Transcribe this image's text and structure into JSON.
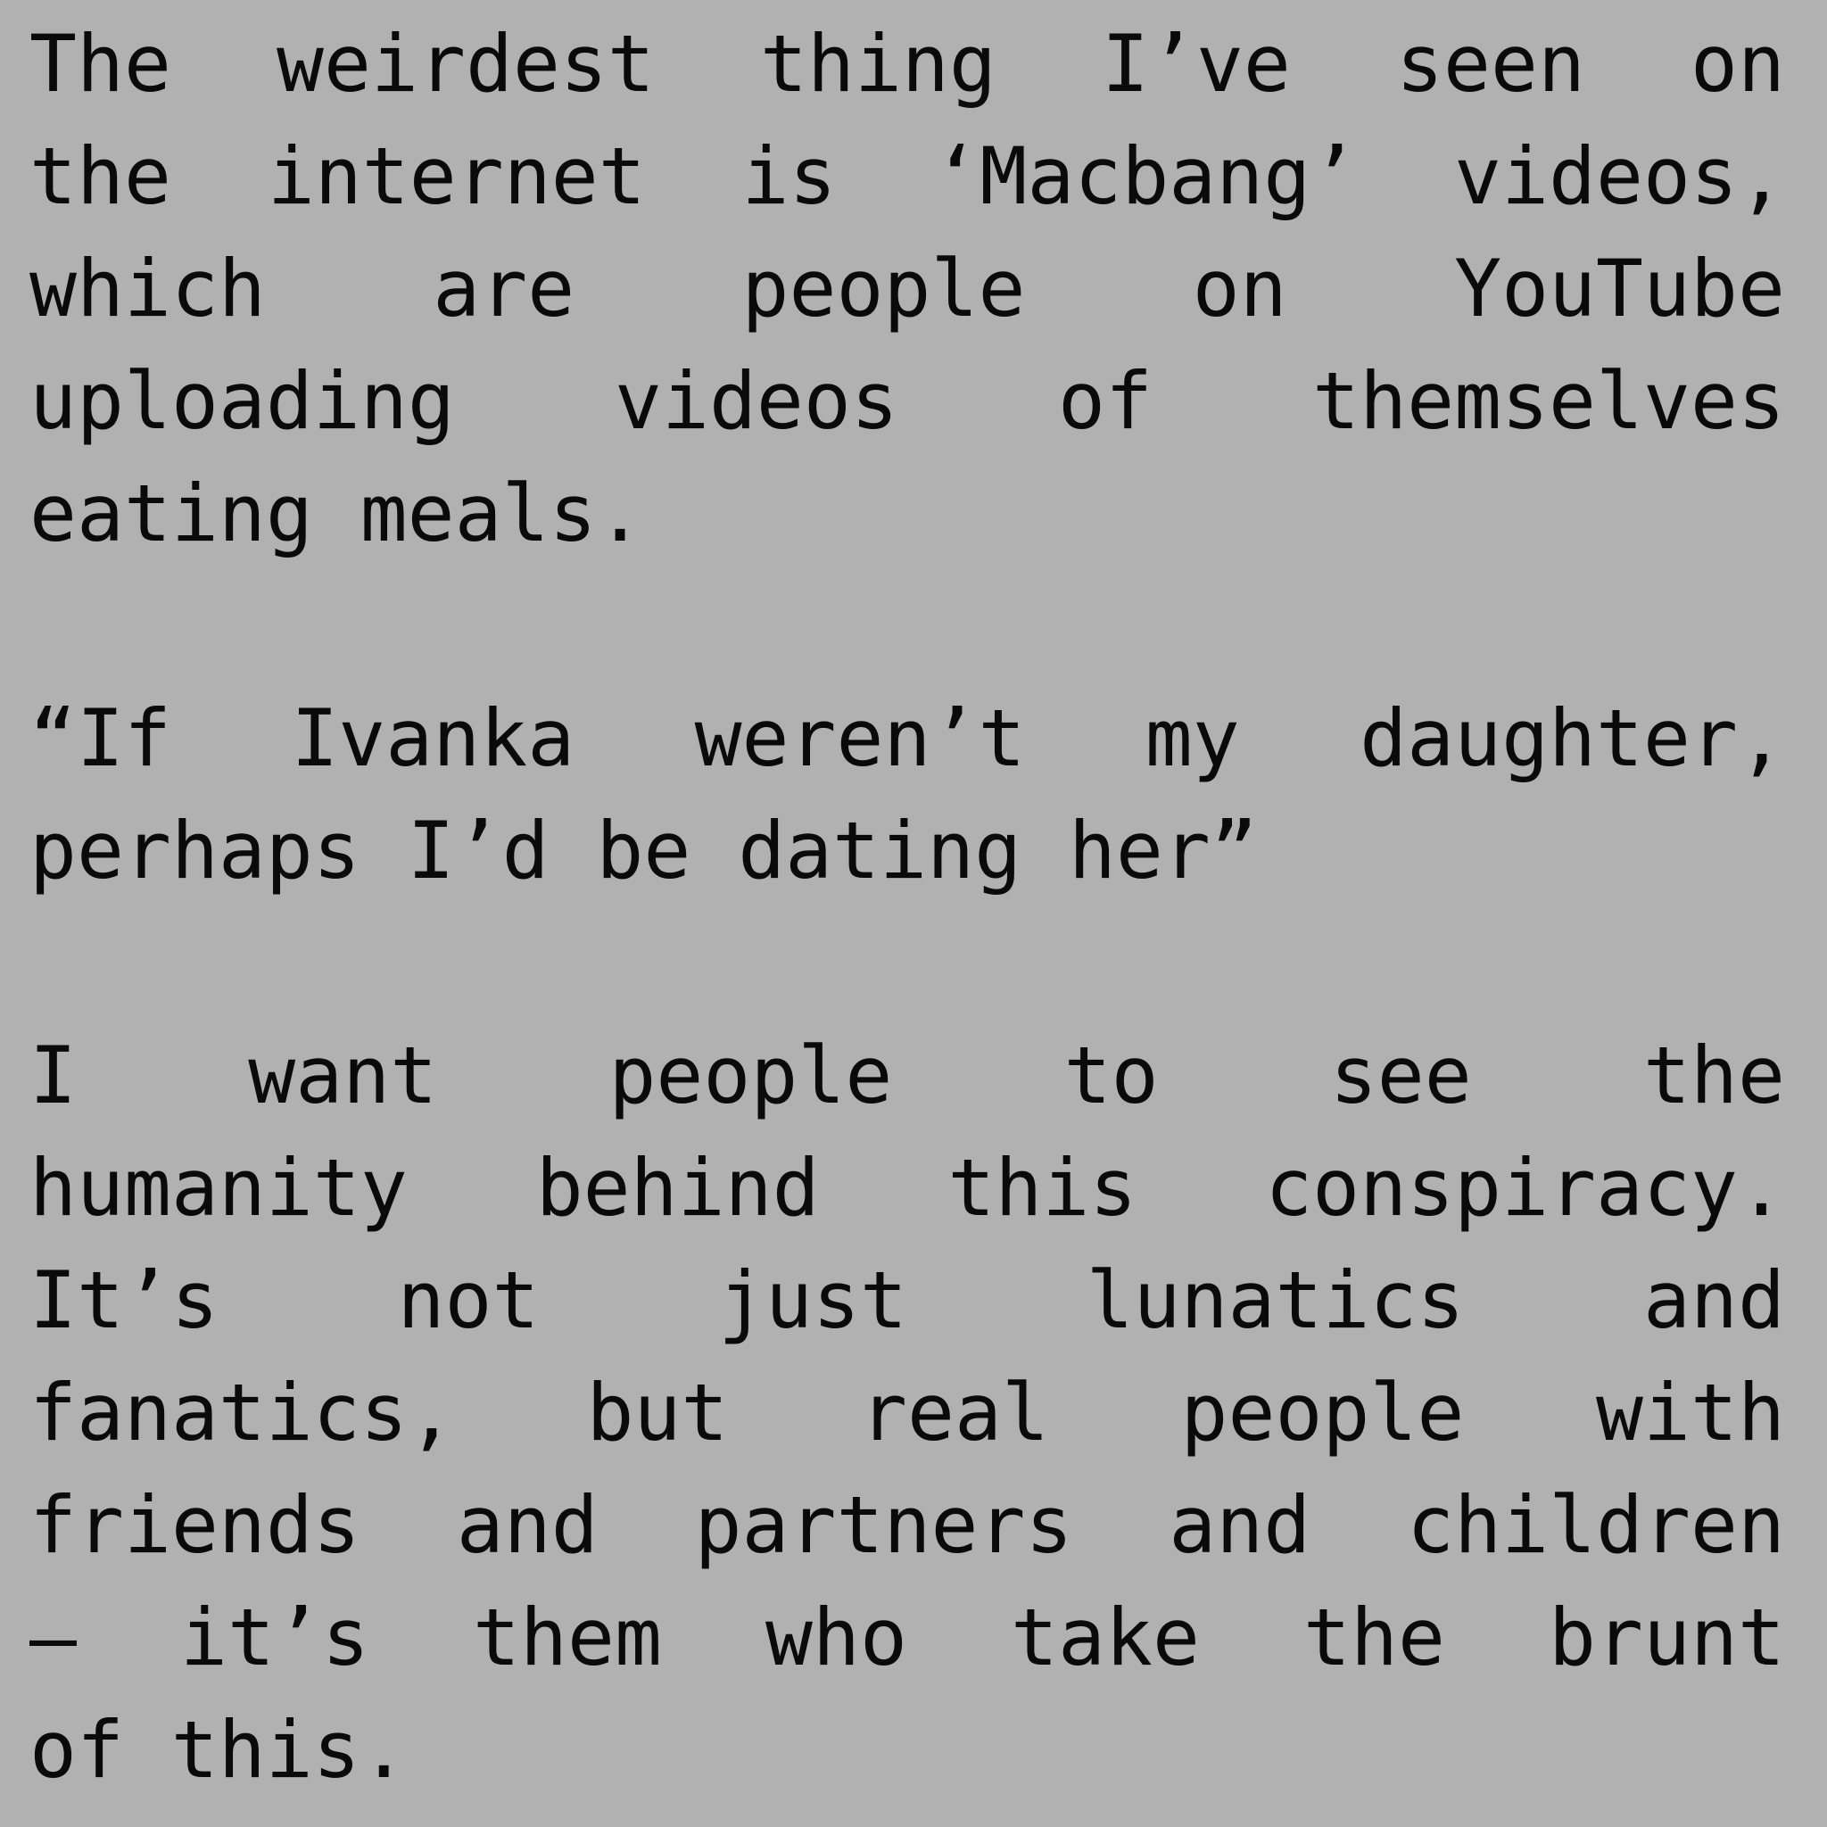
{
  "paragraphs": [
    {
      "lines": [
        [
          "The",
          "weirdest",
          "thing",
          "I’ve",
          "seen",
          "on"
        ],
        [
          "the",
          "internet",
          "is",
          "‘Macbang’",
          "videos,"
        ],
        [
          "which",
          "are",
          "people",
          "on",
          "YouTube"
        ],
        [
          "uploading",
          "videos",
          "of",
          "themselves"
        ],
        [
          "eating",
          "meals."
        ]
      ]
    },
    {
      "lines": [
        [
          "“If",
          "Ivanka",
          "weren’t",
          "my",
          "daughter,"
        ],
        [
          "perhaps",
          "I’d",
          "be",
          "dating",
          "her”"
        ]
      ]
    },
    {
      "lines": [
        [
          "I",
          "want",
          "people",
          "to",
          "see",
          "the"
        ],
        [
          "humanity",
          "behind",
          "this",
          "conspiracy."
        ],
        [
          "It’s",
          "not",
          "just",
          "lunatics",
          "and"
        ],
        [
          "fanatics,",
          "but",
          "real",
          "people",
          "with"
        ],
        [
          "friends",
          "and",
          "partners",
          "and",
          "children"
        ],
        [
          "–",
          "it’s",
          "them",
          "who",
          "take",
          "the",
          "brunt"
        ],
        [
          "of",
          "this."
        ]
      ]
    }
  ]
}
